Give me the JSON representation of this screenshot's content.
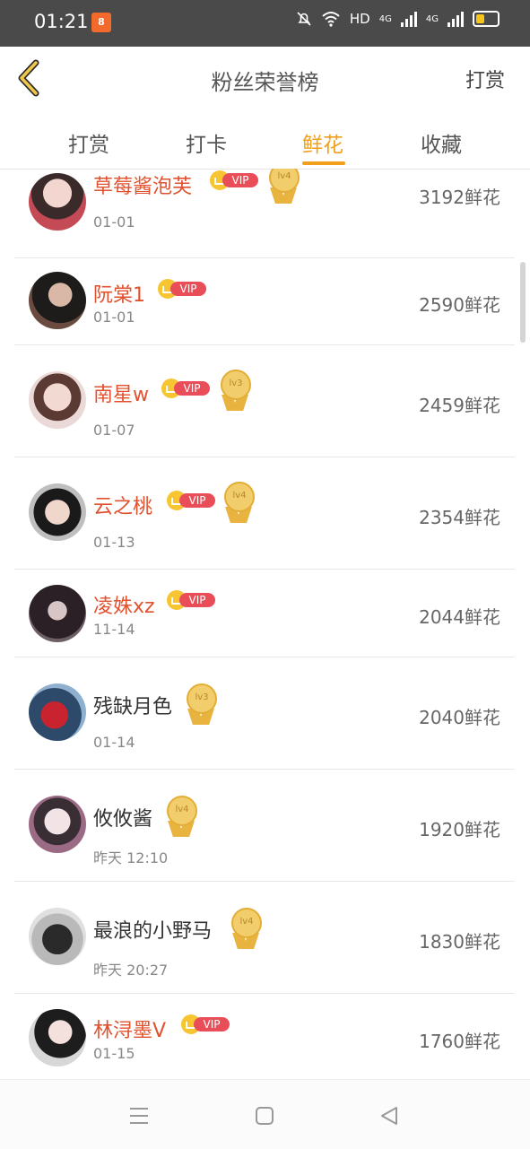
{
  "status_bar": {
    "time": "01:21",
    "network": "HD",
    "signal1": "4G",
    "signal2": "4G"
  },
  "header": {
    "title": "粉丝荣誉榜",
    "action": "打赏"
  },
  "tabs": [
    {
      "label": "打赏",
      "active": false
    },
    {
      "label": "打卡",
      "active": false
    },
    {
      "label": "鲜花",
      "active": true
    },
    {
      "label": "收藏",
      "active": false
    }
  ],
  "vip_label": "VIP",
  "items": [
    {
      "name": "草莓酱泡芙",
      "vip": true,
      "level": "lv4",
      "date": "01-01",
      "count": "3192鲜花"
    },
    {
      "name": "阮棠1",
      "vip": true,
      "level": "",
      "date": "01-01",
      "count": "2590鲜花"
    },
    {
      "name": "南星w",
      "vip": true,
      "level": "lv3",
      "date": "01-07",
      "count": "2459鲜花"
    },
    {
      "name": "云之桃",
      "vip": true,
      "level": "lv4",
      "date": "01-13",
      "count": "2354鲜花"
    },
    {
      "name": "凌姝xz",
      "vip": true,
      "level": "",
      "date": "11-14",
      "count": "2044鲜花"
    },
    {
      "name": "残缺月色",
      "vip": false,
      "level": "lv3",
      "date": "01-14",
      "count": "2040鲜花"
    },
    {
      "name": "攸攸酱",
      "vip": false,
      "level": "lv4",
      "date": "昨天 12:10",
      "count": "1920鲜花"
    },
    {
      "name": "最浪的小野马",
      "vip": false,
      "level": "lv4",
      "date": "昨天 20:27",
      "count": "1830鲜花"
    },
    {
      "name": "林浔墨V",
      "vip": true,
      "level": "",
      "date": "01-15",
      "count": "1760鲜花"
    }
  ],
  "colors": {
    "accent": "#f0a01c",
    "vip_name": "#e0522f",
    "vip_pill": "#e94e58",
    "status_bar": "#4a4a4a"
  },
  "icons": {
    "back": "chevron-left-icon",
    "menu": "menu-icon",
    "home": "home-icon",
    "nav_back": "triangle-back-icon"
  }
}
